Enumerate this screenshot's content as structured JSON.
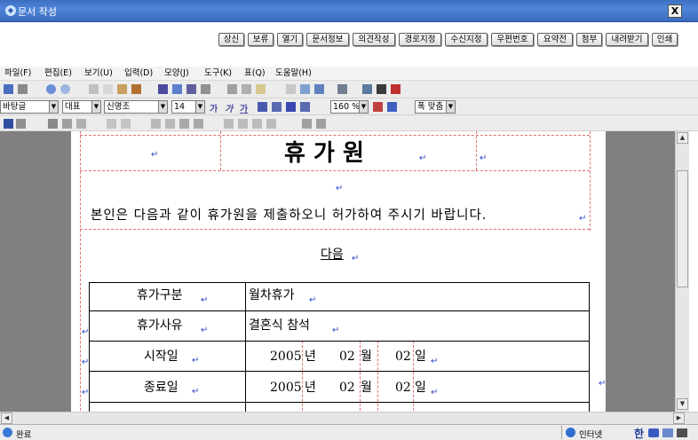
{
  "window": {
    "title": "문서 작성",
    "close_label": "X"
  },
  "actions": [
    {
      "name": "상신"
    },
    {
      "name": "보류"
    },
    {
      "name": "열기"
    },
    {
      "name": "문서정보"
    },
    {
      "name": "의견작성"
    },
    {
      "name": "경로지정"
    },
    {
      "name": "수신지정"
    },
    {
      "name": "우편번호"
    },
    {
      "name": "요약전"
    },
    {
      "name": "첨부"
    },
    {
      "name": "내려받기"
    },
    {
      "name": "인쇄"
    }
  ],
  "menu": [
    "파일(F)",
    "편집(E)",
    "보기(U)",
    "입력(D)",
    "모양(J)",
    "도구(K)",
    "표(Q)",
    "도움말(H)"
  ],
  "format": {
    "style": "바탕글",
    "font_kind": "대표",
    "font": "신명조",
    "size": "14",
    "zoom": "160 %",
    "fit": "폭 맞춤",
    "char_buttons": [
      "가",
      "가",
      "가"
    ]
  },
  "document": {
    "title": "휴 가 원",
    "intro": "본인은 다음과 같이 휴가원을 제출하오니 허가하여 주시기 바랍니다.",
    "heading": "다음",
    "rows": [
      {
        "label": "휴가구분",
        "value": "월차휴가"
      },
      {
        "label": "휴가사유",
        "value": "결혼식 참석"
      },
      {
        "label": "시작일",
        "year": "2005",
        "y_unit": "년",
        "month": "02",
        "m_unit": "월",
        "day": "02",
        "d_unit": "일"
      },
      {
        "label": "종료일",
        "year": "2005",
        "y_unit": "년",
        "month": "02",
        "m_unit": "월",
        "day": "02",
        "d_unit": "일"
      }
    ],
    "para_mark": "↵"
  },
  "status": {
    "left": "완료",
    "zone": "인터넷",
    "ime": "한"
  }
}
